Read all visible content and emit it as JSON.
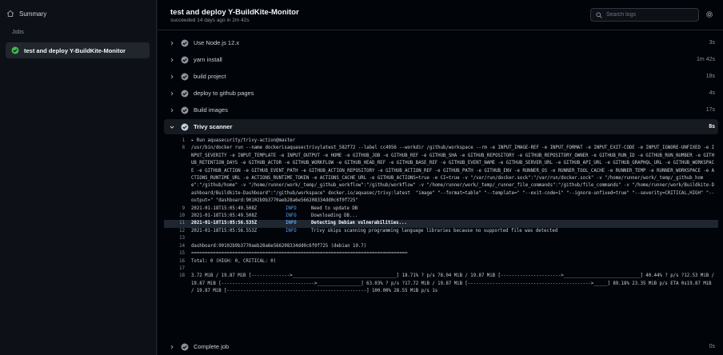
{
  "sidebar": {
    "summary_label": "Summary",
    "jobs_label": "Jobs",
    "job_label": "test and deploy Y-BuildKite-Monitor"
  },
  "header": {
    "title": "test and deploy Y-BuildKite-Monitor",
    "subtitle": "succeeded 14 days ago in 2m 42s",
    "search_placeholder": "Search logs"
  },
  "steps": [
    {
      "name": "Use Node.js 12.x",
      "duration": "3s"
    },
    {
      "name": "yarn install",
      "duration": "1m 42s"
    },
    {
      "name": "build project",
      "duration": "18s"
    },
    {
      "name": "deploy to github pages",
      "duration": "4s"
    },
    {
      "name": "Build images",
      "duration": "17s"
    },
    {
      "name": "Trivy scanner",
      "duration": "8s"
    }
  ],
  "final_step": {
    "name": "Complete job",
    "duration": "0s"
  },
  "log": {
    "l1": "▸ Run aquasecurity/trivy-action@master",
    "l8": "/usr/bin/docker run --name dockerisaquasectrivylatest_582f72 --label cc4956 --workdir /github/workspace --rm -e INPUT_IMAGE-REF -e INPUT_FORMAT -e INPUT_EXIT-CODE -e INPUT_IGNORE-UNFIXED -e INPUT_SEVERITY -e INPUT_TEMPLATE -e INPUT_OUTPUT -e HOME -e GITHUB_JOB -e GITHUB_REF -e GITHUB_SHA -e GITHUB_REPOSITORY -e GITHUB_REPOSITORY_OWNER -e GITHUB_RUN_ID -e GITHUB_RUN_NUMBER -e GITHUB_RETENTION_DAYS -e GITHUB_ACTOR -e GITHUB_WORKFLOW -e GITHUB_HEAD_REF -e GITHUB_BASE_REF -e GITHUB_EVENT_NAME -e GITHUB_SERVER_URL -e GITHUB_API_URL -e GITHUB_GRAPHQL_URL -e GITHUB_WORKSPACE -e GITHUB_ACTION -e GITHUB_EVENT_PATH -e GITHUB_ACTION_REPOSITORY -e GITHUB_ACTION_REF -e GITHUB_PATH -e GITHUB_ENV -e RUNNER_OS -e RUNNER_TOOL_CACHE -e RUNNER_TEMP -e RUNNER_WORKSPACE -e ACTIONS_RUNTIME_URL -e ACTIONS_RUNTIME_TOKEN -e ACTIONS_CACHE_URL -e GITHUB_ACTIONS=true -e CI=true -v \"/var/run/docker.sock\":\"/var/run/docker.sock\" -v \"/home/runner/work/_temp/_github_home\":\"/github/home\" -v \"/home/runner/work/_temp/_github_workflow\":\"/github/workflow\" -v \"/home/runner/work/_temp/_runner_file_commands\":\"/github/file_commands\" -v \"/home/runner/work/Buildkite-Dashboard/Buildkite-Dashboard\":\"/github/workspace\" docker.io/aquasec/trivy:latest  \"image\" \"--format=table\" \"--template=\" \"--exit-code=1\" \"--ignore-unfixed=true\" \"--severity=CRITICAL,HIGH\" \"--output=\" \"dashboard:90102b9b3770aeb28a6e566208334dd0c6f0f725\"",
    "rows": [
      {
        "no": "9",
        "ts": "2021-01-18T15:05:49.508Z",
        "lvl": "INFO",
        "msg": "Need to update DB"
      },
      {
        "no": "10",
        "ts": "2021-01-18T15:05:49.508Z",
        "lvl": "INFO",
        "msg": "Downloading DB..."
      },
      {
        "no": "11",
        "ts": "2021-01-18T15:05:56.535Z",
        "lvl": "INFO",
        "msg": "Detecting Debian vulnerabilities..."
      },
      {
        "no": "12",
        "ts": "2021-01-18T15:05:56.553Z",
        "lvl": "INFO",
        "msg": "Trivy skips scanning programming language libraries because no supported file was detected"
      }
    ],
    "l14": "dashboard:90102b9b3770aeb28a6e566208334dd0c6f0f725 (debian 10.7)",
    "l15": "===============================================================================",
    "l16": "Total: 0 (HIGH: 0, CRITICAL: 0)",
    "l18": "3.72 MiB / 19.87 MiB [-------------->______________________________________] 18.71% ? p/s 78.04 MiB / 19.87 MiB [---------------------->____________________________] 40.44% ? p/s ?12.53 MiB / 19.87 MiB [---------------------------------->________________] 63.03% ? p/s ?17.72 MiB / 19.87 MiB [--------------------------------------------->_____] 89.18% 23.35 MiB p/s ETA 0s19.87 MiB / 19.87 MiB [---------------------------------------------------] 100.00% 28.55 MiB p/s 1s"
  }
}
